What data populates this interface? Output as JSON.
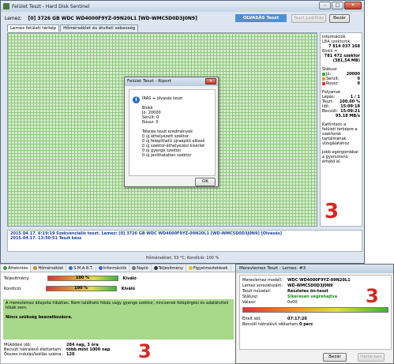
{
  "main_window": {
    "title": "Felület Teszt - Hard Disk Sentinel",
    "window_buttons": {
      "minimize": "–",
      "maximize": "□",
      "close": "✕"
    },
    "drive_label": "Lemez:",
    "drive_value": "[0] 3726 GB  WDC WD4000F9YZ-09N20L1 [WD-WMC5D0D3J0N9]",
    "mode_badge": "OLVASÁS Teszt",
    "btn_start_disabled": "Teszt Leállítás",
    "btn_close": "Bezár",
    "tabs": [
      "Lemez felületi térkép",
      "Hőmérséklet és átviteli sebesség"
    ],
    "side_panel": {
      "info_title": "Információk",
      "lba_label": "LBA szektorok",
      "lba_value": "7 814 037 168",
      "blocks_label": "Blokk =",
      "blocks_value": "781 472 szektor",
      "blocks_mb": "(381,54 MB)",
      "status_title": "Státusz",
      "good_label": "Jó:",
      "good_value": "20000",
      "damaged_label": "Sérült:",
      "damaged_value": "0",
      "bad_label": "Rossz:",
      "bad_value": "0",
      "progress_title": "Folyamat",
      "pass_label": "Lépés:",
      "pass_value": "1 / 1",
      "test_label": "Teszt:",
      "test_value": "100.00 %",
      "time_label": "Idő:",
      "time_value": "15:09:18",
      "est_label": "Becsült:",
      "est_value": "15:09:21",
      "speed_value": "95.18 MB/s",
      "hint1": "Kattintson a felületi térképre a szektorok tartalmának vizsgálatához.",
      "hint2": "Jobb egérgombbal a gyorsmenü érhető el."
    },
    "dialog": {
      "title": "Felület Teszt - Riport",
      "close": "✕",
      "info_icon": "i",
      "lines": [
        "ÍRÁS + olvasás teszt",
        "",
        "Blokk",
        "  Jó: 20000",
        "  Sérült: 0",
        "  Rossz: 0",
        "",
        "Tételes teszt eredmények",
        "  0 új áthelyezett szektor",
        "  0 új felépíthető újraépítő elkező",
        "  0 új szektor-áthelyezési kísérlet",
        "  0 új gyenge szektor",
        "  0 új javíthatatlan szektor"
      ],
      "ok": "OK"
    },
    "log": [
      {
        "date": "2015.04.17.",
        "time": "6:19:19",
        "text": "Szekvenciális teszt. Lemez: [0] 3726 GB  WDC WD4000F9YZ-09N20L1 [WD-WMC5D0D3J0N9] [Olvasás]"
      },
      {
        "date": "2015.04.17.",
        "time": "13:50:51",
        "text": "Teszt kész"
      }
    ],
    "statusbar": "Hőmérséklet: 33 °C,  Kondíció: 100 %"
  },
  "bottom_window": {
    "tabs": [
      "Áttekintés",
      "Hőmérséklet",
      "S.M.A.R.T.",
      "Információk",
      "Napló",
      "Teljesítmény",
      "Figyelmeztetések"
    ],
    "health_label": "Teljesítmény:",
    "health_value": "100 %",
    "health_text": "Kiváló",
    "cond_label": "Kondíció:",
    "cond_value": "100 %",
    "cond_text": "Kiváló",
    "message": "A merevlemez állapota hibátlan. Nem található hibás vagy gyenge szektor, nincsenek felépörgési és adatátviteli hibák sem.",
    "message_bold": "Nincs szükség beavatkozásra.",
    "stats": [
      {
        "k": "Működési idő:",
        "v": "284 nap, 3 óra"
      },
      {
        "k": "Becsült hátralévő élettartam:",
        "v": "több mint 1000 nap"
      },
      {
        "k": "Összes indulás/leállás száma:",
        "v": "120"
      }
    ],
    "health_fraction": 1.0,
    "cond_fraction": 1.0
  },
  "test_dialog": {
    "title": "Merevlemez Teszt - Lemez: #3",
    "rows": [
      {
        "k": "Merevlemez modell:",
        "v": "WDC WD4000F9YZ-09N20L1"
      },
      {
        "k": "Lemez sorozatszám:",
        "v": "WD-WMC5D0D3J0N9"
      },
      {
        "k": "Teszt művelet:",
        "v": "Részletes ön-teszt"
      },
      {
        "k": "Státusz:",
        "v": "Sikeresen végrehajtva"
      },
      {
        "k": "Válasz:",
        "v": "0x00"
      }
    ],
    "elapsed_label": "Eltelt idő:",
    "elapsed_value": "07:17:20",
    "remaining_label": "Becsült hátralévő időtartam:",
    "remaining_value": "0 perc",
    "btn_close": "Bezár",
    "btn_hide": "Háttérben",
    "progress_fraction": 1.0
  },
  "annotations": [
    "3",
    "3",
    "3"
  ],
  "colors": {
    "annotation": "#d8281e",
    "accent": "#4a90d8",
    "grid_green": "#8ec77e"
  }
}
